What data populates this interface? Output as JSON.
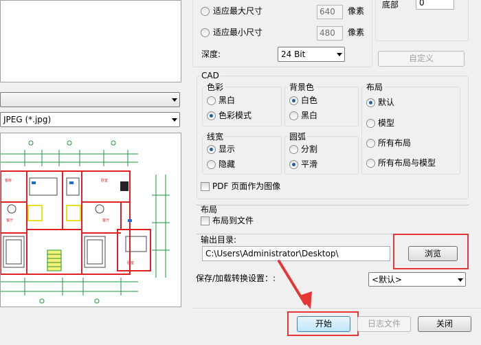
{
  "left": {
    "combo_top": "",
    "format_combo": "JPEG (*.jpg)"
  },
  "size": {
    "fit_max_label": "适应最大尺寸",
    "fit_max_value": "640",
    "fit_max_unit": "像素",
    "fit_min_label": "适应最小尺寸",
    "fit_min_value": "480",
    "fit_min_unit": "像素",
    "depth_label": "深度:",
    "depth_value": "24 Bit",
    "bottom_label": "底部",
    "bottom_value": "0",
    "custom_button": "自定义"
  },
  "cad": {
    "title": "CAD",
    "color": {
      "title": "色彩",
      "options": [
        "黑白",
        "色彩模式"
      ],
      "selected": 1
    },
    "background": {
      "title": "背景色",
      "options": [
        "白色",
        "黑白"
      ],
      "selected": 0
    },
    "layout": {
      "title": "布局",
      "options": [
        "默认",
        "模型",
        "所有布局",
        "所有布局与模型"
      ],
      "selected": 0
    },
    "linewidth": {
      "title": "线宽",
      "options": [
        "显示",
        "隐藏"
      ],
      "selected": 0
    },
    "arc": {
      "title": "圆弧",
      "options": [
        "分割",
        "平滑"
      ],
      "selected": 1
    },
    "pdf_as_image": "PDF 页面作为图像"
  },
  "layout_section": {
    "title": "布局",
    "layout_to_file": "布局到文件"
  },
  "output": {
    "label": "输出目录:",
    "path": "C:\\Users\\Administrator\\Desktop\\",
    "browse_button": "浏览"
  },
  "settings": {
    "label": "保存/加载转换设置：:",
    "value": "<默认>"
  },
  "footer": {
    "start_button": "开始",
    "log_button": "日志文件",
    "close_button": "关闭"
  },
  "colors": {
    "highlight": "#e53535",
    "radio_dot": "#1d5fa8",
    "drawing_red": "#e02020",
    "drawing_green": "#1a9a3a",
    "drawing_yellow": "#e8e020"
  }
}
